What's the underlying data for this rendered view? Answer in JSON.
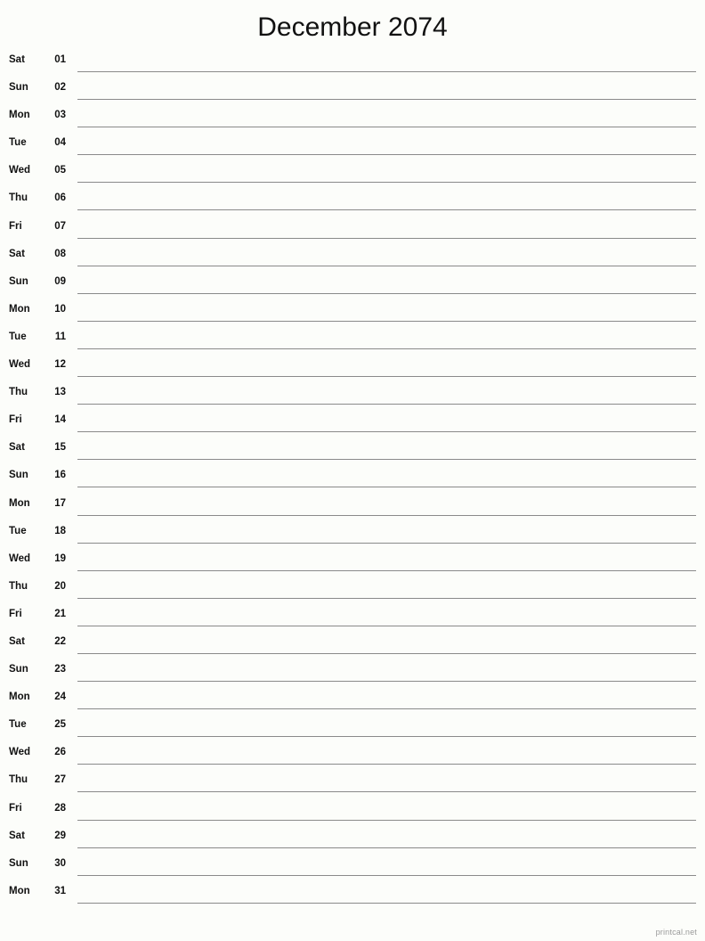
{
  "document": {
    "title": "December 2074",
    "month_name": "December",
    "year": "2074",
    "watermark": "printcal.net"
  },
  "colors": {
    "background": "#fcfdfa",
    "text": "#111111",
    "rule_line": "#8a8a8a",
    "watermark": "#9a9a9a"
  },
  "days": [
    {
      "weekday": "Sat",
      "number": "01"
    },
    {
      "weekday": "Sun",
      "number": "02"
    },
    {
      "weekday": "Mon",
      "number": "03"
    },
    {
      "weekday": "Tue",
      "number": "04"
    },
    {
      "weekday": "Wed",
      "number": "05"
    },
    {
      "weekday": "Thu",
      "number": "06"
    },
    {
      "weekday": "Fri",
      "number": "07"
    },
    {
      "weekday": "Sat",
      "number": "08"
    },
    {
      "weekday": "Sun",
      "number": "09"
    },
    {
      "weekday": "Mon",
      "number": "10"
    },
    {
      "weekday": "Tue",
      "number": "11"
    },
    {
      "weekday": "Wed",
      "number": "12"
    },
    {
      "weekday": "Thu",
      "number": "13"
    },
    {
      "weekday": "Fri",
      "number": "14"
    },
    {
      "weekday": "Sat",
      "number": "15"
    },
    {
      "weekday": "Sun",
      "number": "16"
    },
    {
      "weekday": "Mon",
      "number": "17"
    },
    {
      "weekday": "Tue",
      "number": "18"
    },
    {
      "weekday": "Wed",
      "number": "19"
    },
    {
      "weekday": "Thu",
      "number": "20"
    },
    {
      "weekday": "Fri",
      "number": "21"
    },
    {
      "weekday": "Sat",
      "number": "22"
    },
    {
      "weekday": "Sun",
      "number": "23"
    },
    {
      "weekday": "Mon",
      "number": "24"
    },
    {
      "weekday": "Tue",
      "number": "25"
    },
    {
      "weekday": "Wed",
      "number": "26"
    },
    {
      "weekday": "Thu",
      "number": "27"
    },
    {
      "weekday": "Fri",
      "number": "28"
    },
    {
      "weekday": "Sat",
      "number": "29"
    },
    {
      "weekday": "Sun",
      "number": "30"
    },
    {
      "weekday": "Mon",
      "number": "31"
    }
  ]
}
